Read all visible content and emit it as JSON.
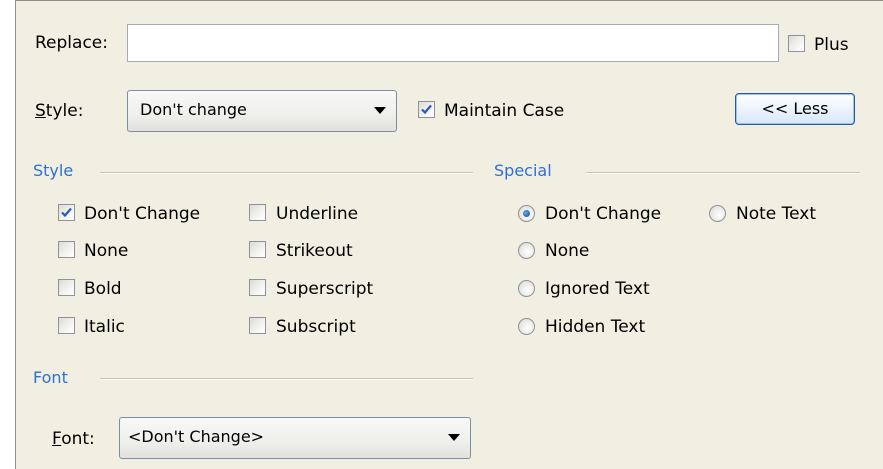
{
  "replace": {
    "label": "Replace:",
    "value": "",
    "placeholder": ""
  },
  "plus": {
    "label": "Plus",
    "checked": false
  },
  "style_row": {
    "label_first": "S",
    "label_rest": "tyle:",
    "combo_value": "Don't change",
    "maintain_case": {
      "label": "Maintain Case",
      "checked": true
    },
    "less_button": "<< Less"
  },
  "style_group": {
    "title": "Style",
    "col1": [
      {
        "label": "Don't Change",
        "checked": true
      },
      {
        "label": "None",
        "checked": false
      },
      {
        "label": "Bold",
        "checked": false
      },
      {
        "label": "Italic",
        "checked": false
      }
    ],
    "col2": [
      {
        "label": "Underline",
        "checked": false
      },
      {
        "label": "Strikeout",
        "checked": false
      },
      {
        "label": "Superscript",
        "checked": false
      },
      {
        "label": "Subscript",
        "checked": false
      }
    ]
  },
  "special_group": {
    "title": "Special",
    "options": [
      {
        "label": "Don't Change",
        "selected": true
      },
      {
        "label": "None",
        "selected": false
      },
      {
        "label": "Ignored Text",
        "selected": false
      },
      {
        "label": "Hidden Text",
        "selected": false
      },
      {
        "label": "Note Text",
        "selected": false
      }
    ]
  },
  "font_group": {
    "title": "Font",
    "label_first": "F",
    "label_rest": "ont:",
    "combo_value": "<Don't Change>"
  },
  "colors": {
    "panel": "#f1efe2",
    "group_title": "#2f6fd6",
    "accent_border": "#26589e"
  }
}
